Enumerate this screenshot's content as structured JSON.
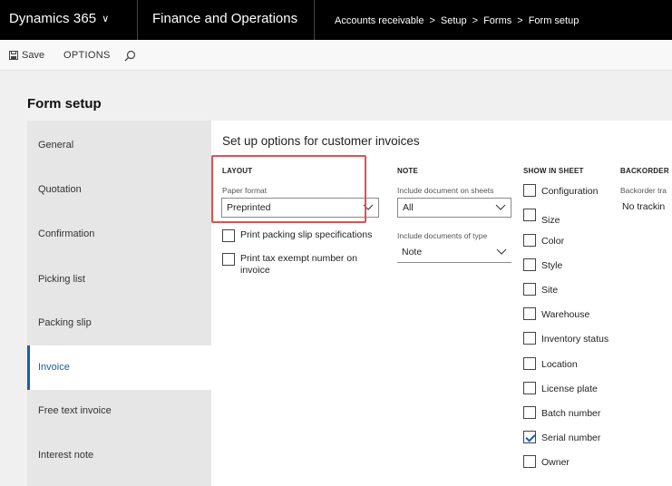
{
  "nav": {
    "app_title": "Dynamics 365",
    "app_chevron": "∨",
    "module": "Finance and Operations",
    "breadcrumb": [
      "Accounts receivable",
      "Setup",
      "Forms",
      "Form setup"
    ],
    "breadcrumb_separator": ">"
  },
  "actions": {
    "save_label": "Save",
    "options_label": "OPTIONS"
  },
  "page": {
    "title": "Form setup"
  },
  "tabs": [
    {
      "label": "General",
      "active": false
    },
    {
      "label": "Quotation",
      "active": false
    },
    {
      "label": "Confirmation",
      "active": false
    },
    {
      "label": "Picking list",
      "active": false
    },
    {
      "label": "Packing slip",
      "active": false
    },
    {
      "label": "Invoice",
      "active": true
    },
    {
      "label": "Free text invoice",
      "active": false
    },
    {
      "label": "Interest note",
      "active": false
    }
  ],
  "panel": {
    "heading": "Set up options for customer invoices",
    "layout": {
      "title": "LAYOUT",
      "paper_format_label": "Paper format",
      "paper_format_value": "Preprinted",
      "print_packing_slip_label": "Print packing slip specifications",
      "print_packing_slip_checked": false,
      "print_tax_exempt_label": "Print tax exempt number on invoice",
      "print_tax_exempt_checked": false
    },
    "note": {
      "title": "NOTE",
      "include_doc_label": "Include document on sheets",
      "include_doc_value": "All",
      "include_types_label": "Include documents of type",
      "include_types_value": "Note"
    },
    "show_in_sheet": {
      "title": "SHOW IN SHEET",
      "items": [
        {
          "label": "Configuration",
          "checked": false
        },
        {
          "label": "Size",
          "checked": false
        },
        {
          "label": "Color",
          "checked": false
        },
        {
          "label": "Style",
          "checked": false
        },
        {
          "label": "Site",
          "checked": false
        },
        {
          "label": "Warehouse",
          "checked": false
        },
        {
          "label": "Inventory status",
          "checked": false
        },
        {
          "label": "Location",
          "checked": false
        },
        {
          "label": "License plate",
          "checked": false
        },
        {
          "label": "Batch number",
          "checked": false
        },
        {
          "label": "Serial number",
          "checked": true
        },
        {
          "label": "Owner",
          "checked": false
        }
      ]
    },
    "backorder": {
      "title": "BACKORDER",
      "tracking_label": "Backorder tra",
      "tracking_value": "No trackin"
    }
  },
  "colors": {
    "accent": "#1a5ea6",
    "highlight_border": "#e05050",
    "topbar_bg": "#000000"
  }
}
